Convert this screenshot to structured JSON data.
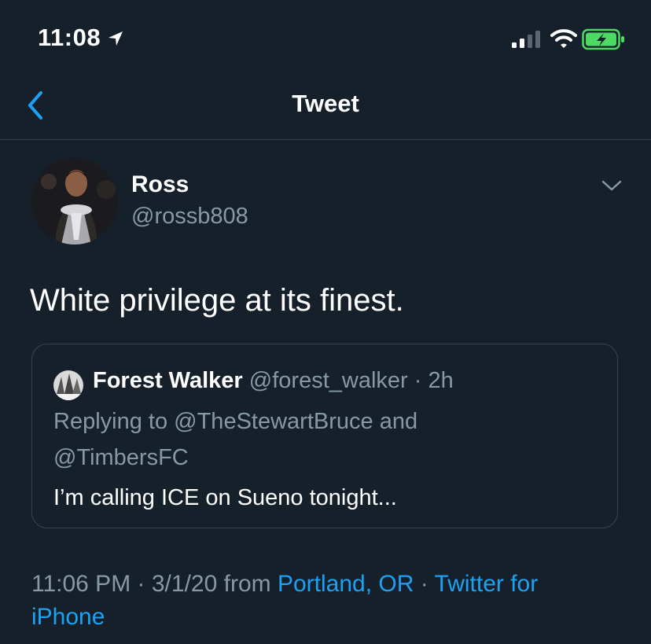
{
  "status_bar": {
    "time": "11:08",
    "icons": [
      "location-arrow-icon",
      "signal-icon",
      "wifi-icon",
      "battery-charging-icon"
    ],
    "battery_color": "#4cd964"
  },
  "nav": {
    "title": "Tweet",
    "back_icon": "chevron-left-icon",
    "accent": "#1da1f2"
  },
  "tweet": {
    "author_name": "Ross",
    "author_handle": "@rossb808",
    "text": "White privilege at its finest.",
    "more_icon": "chevron-down-icon",
    "quoted": {
      "author_name": "Forest Walker",
      "author_handle": "@forest_walker",
      "separator": "·",
      "time_ago": "2h",
      "reply_prefix": "Replying to",
      "reply_user_1": "@TheStewartBruce",
      "reply_conjunction": "and",
      "reply_user_2": "@TimbersFC",
      "text": "I’m calling ICE on Sueno tonight..."
    },
    "meta": {
      "time": "11:06 PM",
      "dot": "·",
      "date": "3/1/20",
      "from_label": "from",
      "location": "Portland, OR",
      "source": "Twitter for",
      "source_cont": "iPhone"
    }
  },
  "colors": {
    "background": "#15202b",
    "secondary_text": "#8899a6",
    "divider": "#38444d",
    "link": "#1da1f2"
  }
}
